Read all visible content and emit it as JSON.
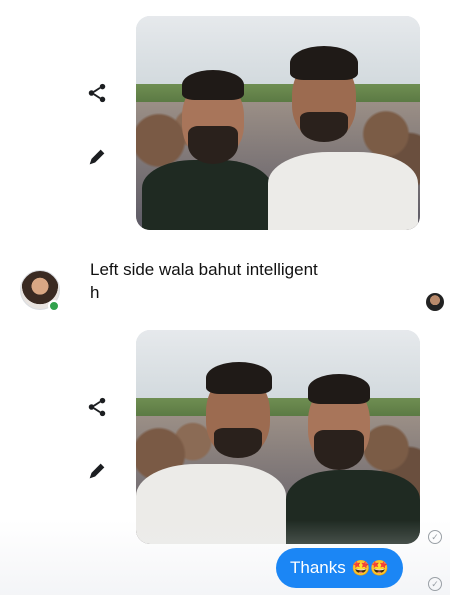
{
  "messages": {
    "photo_one": {
      "alt": "selfie-two-men-crowd-1",
      "actions": [
        "share-icon",
        "edit-icon"
      ]
    },
    "incoming": {
      "text": "Left side wala bahut intelligent h",
      "sender_online": true
    },
    "photo_two": {
      "alt": "selfie-two-men-crowd-2",
      "actions": [
        "share-icon",
        "edit-icon"
      ]
    },
    "sent": {
      "text": "Thanks",
      "emoji": "🤩🤩"
    }
  },
  "colors": {
    "sent_bubble": "#1b86f5",
    "online": "#31a24c",
    "icon": "#1c1e21"
  }
}
